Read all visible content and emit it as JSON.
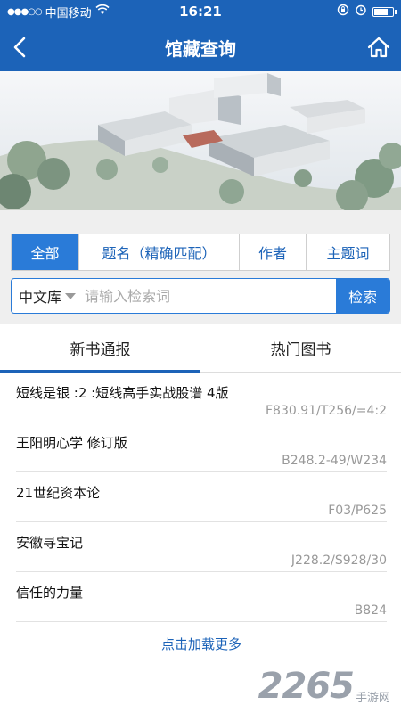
{
  "status": {
    "carrier": "中国移动",
    "time": "16:21",
    "battery_level": 0.85
  },
  "nav": {
    "title": "馆藏查询",
    "back_icon": "chevron-left-icon",
    "home_icon": "home-icon"
  },
  "search": {
    "tabs": [
      {
        "label": "全部",
        "active": true
      },
      {
        "label": "题名（精确匹配）",
        "active": false
      },
      {
        "label": "作者",
        "active": false
      },
      {
        "label": "主题词",
        "active": false
      }
    ],
    "library": "中文库",
    "placeholder": "请输入检索词",
    "button": "检索"
  },
  "list_tabs": [
    {
      "label": "新书通报",
      "active": true
    },
    {
      "label": "热门图书",
      "active": false
    }
  ],
  "books": [
    {
      "title": "短线是银 :2 :短线高手实战股谱 4版",
      "callno": "F830.91/T256/=4:2"
    },
    {
      "title": "王阳明心学 修订版",
      "callno": "B248.2-49/W234"
    },
    {
      "title": "21世纪资本论",
      "callno": "F03/P625"
    },
    {
      "title": "安徽寻宝记",
      "callno": "J228.2/S928/30"
    },
    {
      "title": "信任的力量",
      "callno": "B824"
    }
  ],
  "load_more": "点击加载更多",
  "watermark": {
    "number": "2265",
    "text": "手游网"
  },
  "colors": {
    "primary": "#1c63b8",
    "accent": "#2a7bd8"
  }
}
